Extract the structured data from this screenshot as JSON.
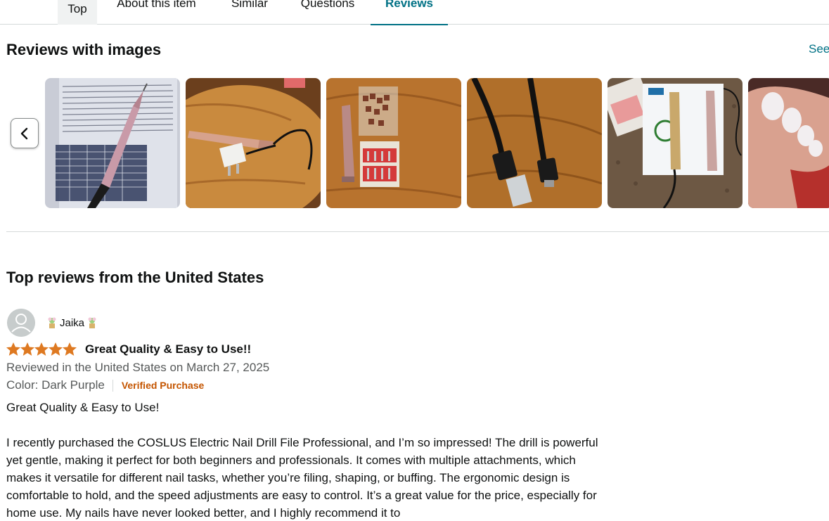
{
  "tabs": [
    {
      "label": "Top"
    },
    {
      "label": "About this item"
    },
    {
      "label": "Similar"
    },
    {
      "label": "Questions"
    },
    {
      "label": "Reviews"
    }
  ],
  "images_section": {
    "title": "Reviews with images",
    "see_all": "See",
    "prev_icon": "chevron-left-icon"
  },
  "top_reviews": {
    "title": "Top reviews from the United States"
  },
  "review": {
    "reviewer_name": "Jaika",
    "rating": 5,
    "rating_max": 5,
    "title": "Great Quality & Easy to Use!!",
    "date": "Reviewed in the United States on March 27, 2025",
    "variant": "Color: Dark Purple",
    "verified": "Verified Purchase",
    "body_first": "Great Quality & Easy to Use!",
    "body_second": "I recently purchased the COSLUS Electric Nail Drill File Professional, and I’m so impressed! The drill is powerful yet gentle, making it perfect for both beginners and professionals. It comes with multiple attachments, which makes it versatile for different nail tasks, whether you’re filing, shaping, or buffing. The ergonomic design is comfortable to hold, and the speed adjustments are easy to control. It’s a great value for the price, especially for home use. My nails have never looked better, and I highly recommend it to"
  },
  "colors": {
    "link": "#007185",
    "star": "#de7921",
    "verified": "#c45500",
    "muted": "#565959"
  }
}
